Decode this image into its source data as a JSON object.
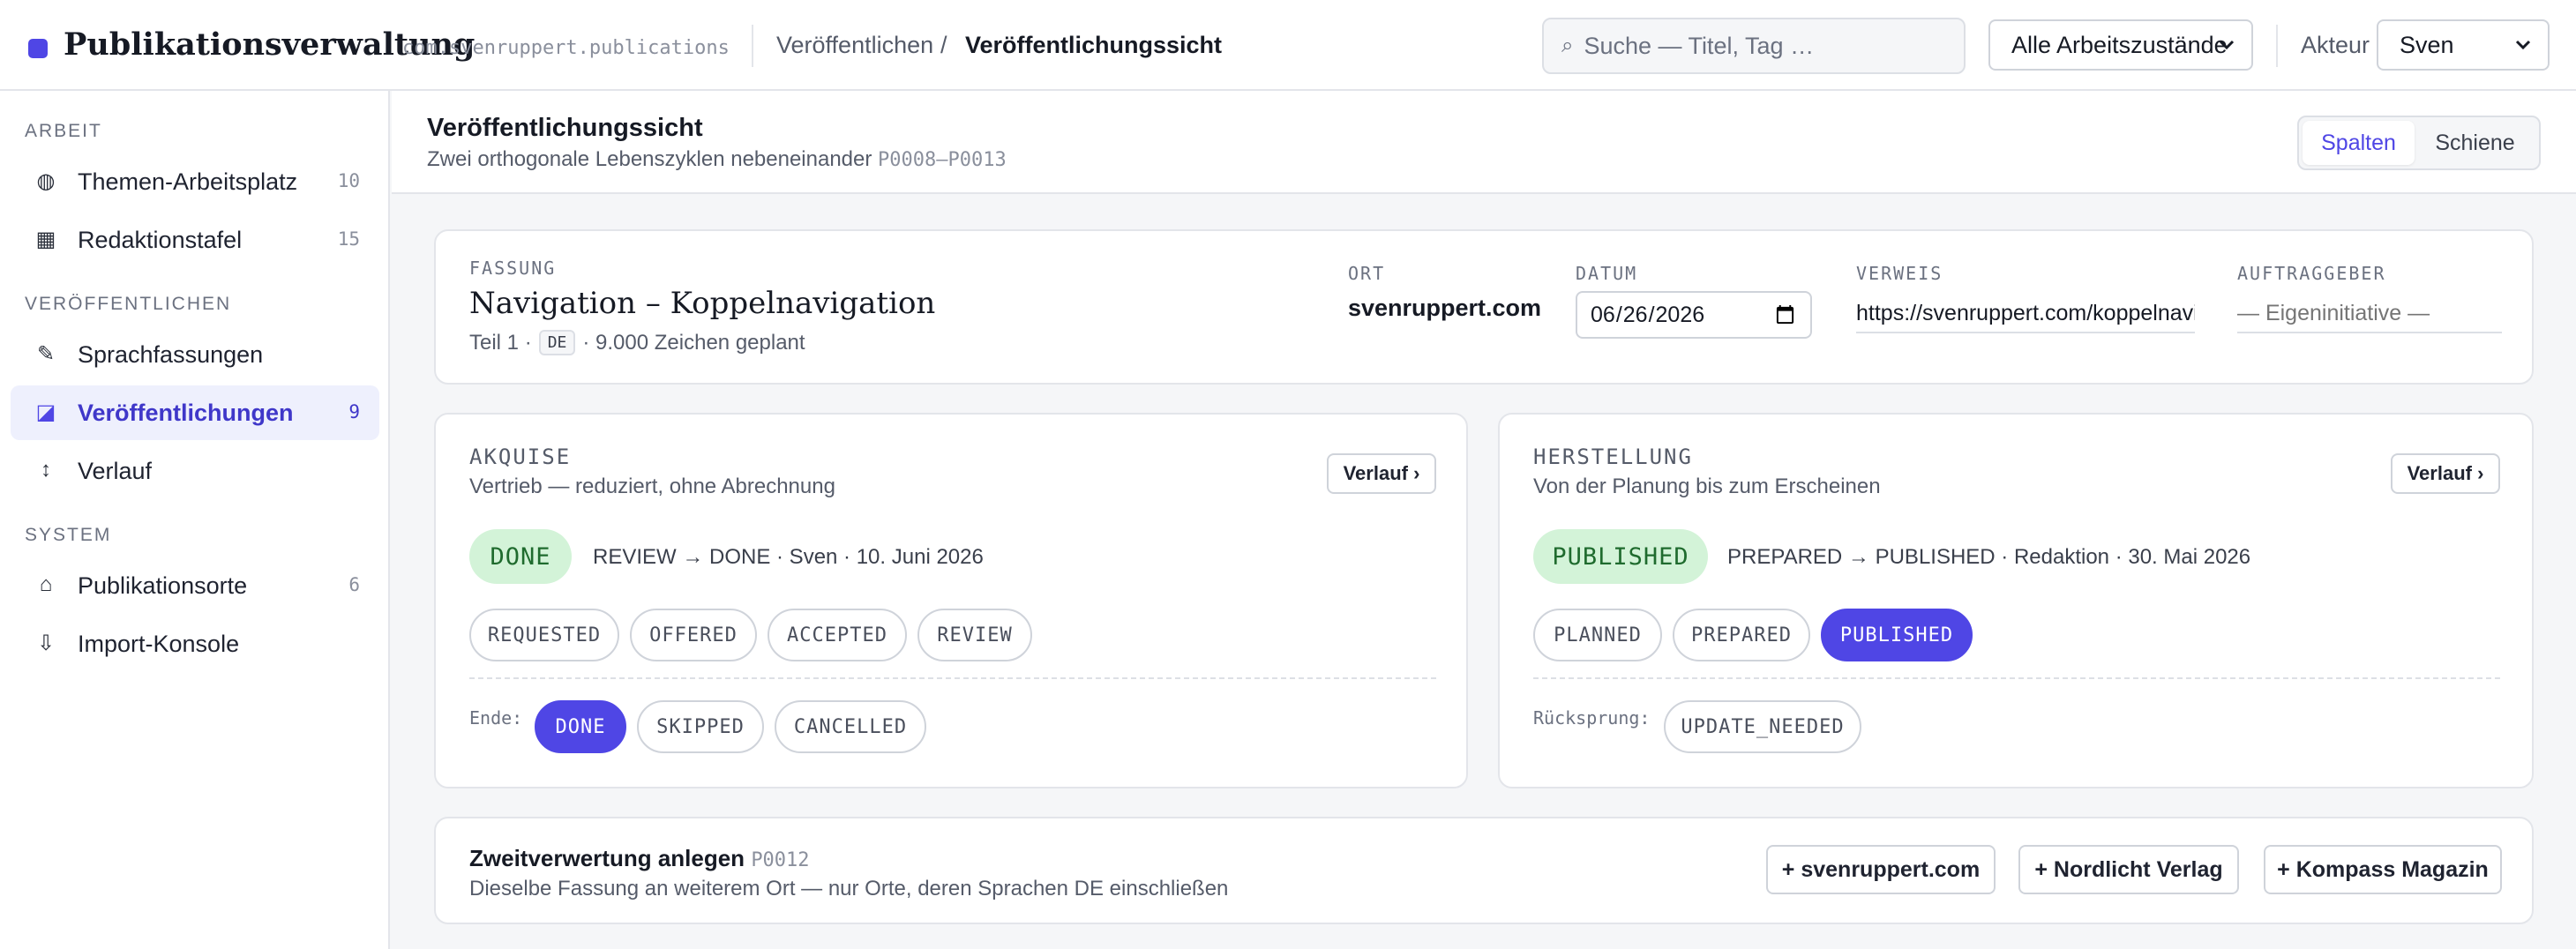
{
  "app": {
    "title": "Publikationsverwaltung",
    "id": "com.svenruppert.publications"
  },
  "breadcrumb": {
    "parent": "Veröffentlichen",
    "separator": "/",
    "current": "Veröffentlichungssicht"
  },
  "search": {
    "placeholder": "Suche — Titel, Tag …",
    "value": "",
    "icon": "search-icon"
  },
  "filter": {
    "selected": "Alle Arbeitszustände"
  },
  "actor": {
    "label": "Akteur",
    "selected": "Sven"
  },
  "sidebar": {
    "sections": [
      {
        "title": "ARBEIT",
        "items": [
          {
            "label": "Themen-Arbeitsplatz",
            "count": "10",
            "icon": "globe-icon",
            "glyph": "◍"
          },
          {
            "label": "Redaktionstafel",
            "count": "15",
            "icon": "board-icon",
            "glyph": "▦"
          }
        ]
      },
      {
        "title": "VERÖFFENTLICHEN",
        "items": [
          {
            "label": "Sprachfassungen",
            "count": "",
            "icon": "pencil-icon",
            "glyph": "✎"
          },
          {
            "label": "Veröffentlichungen",
            "count": "9",
            "icon": "publication-icon",
            "glyph": "◪",
            "active": true
          },
          {
            "label": "Verlauf",
            "count": "",
            "icon": "updown-arrow-icon",
            "glyph": "↕"
          }
        ]
      },
      {
        "title": "SYSTEM",
        "items": [
          {
            "label": "Publikationsorte",
            "count": "6",
            "icon": "home-icon",
            "glyph": "⌂"
          },
          {
            "label": "Import-Konsole",
            "count": "",
            "icon": "download-arrow-icon",
            "glyph": "⇩"
          }
        ]
      }
    ]
  },
  "page": {
    "title": "Veröffentlichungssicht",
    "subtitle": "Zwei orthogonale Lebenszyklen nebeneinander",
    "subtitle_ref": "P0008–P0013",
    "view_toggle": {
      "columns": "Spalten",
      "rail": "Schiene",
      "active": "columns"
    }
  },
  "fassung": {
    "label": "FASSUNG",
    "title": "Navigation – Koppelnavigation",
    "meta_prefix": "Teil 1 ·",
    "lang": "DE",
    "meta_suffix": "· 9.000 Zeichen geplant",
    "ort_label": "ORT",
    "ort": "svenruppert.com",
    "datum_label": "DATUM",
    "datum": "2026-06-26",
    "verweis_label": "VERWEIS",
    "verweis": "https://svenruppert.com/koppelnavigation",
    "auftraggeber_label": "AUFTRAGGEBER",
    "auftraggeber_placeholder": "— Eigeninitiative —"
  },
  "akquise": {
    "label": "AKQUISE",
    "subtitle": "Vertrieb — reduziert, ohne Abrechnung",
    "history_button": "Verlauf ›",
    "state": "DONE",
    "transition": "REVIEW → DONE · Sven · 10. Juni 2026",
    "steps": [
      "REQUESTED",
      "OFFERED",
      "ACCEPTED",
      "REVIEW"
    ],
    "end_label": "Ende:",
    "end_steps": [
      "DONE",
      "SKIPPED",
      "CANCELLED"
    ],
    "selected": "DONE"
  },
  "herstellung": {
    "label": "HERSTELLUNG",
    "subtitle": "Von der Planung bis zum Erscheinen",
    "history_button": "Verlauf ›",
    "state": "PUBLISHED",
    "transition": "PREPARED → PUBLISHED · Redaktion · 30. Mai 2026",
    "steps": [
      "PLANNED",
      "PREPARED",
      "PUBLISHED"
    ],
    "back_label": "Rücksprung:",
    "back_steps": [
      "UPDATE_NEEDED"
    ],
    "selected": "PUBLISHED"
  },
  "zweit": {
    "title": "Zweitverwertung anlegen",
    "ref": "P0012",
    "subtitle": "Dieselbe Fassung an weiterem Ort — nur Orte, deren Sprachen DE einschließen",
    "buttons": [
      "+ svenruppert.com",
      "+ Nordlicht Verlag",
      "+ Kompass Magazin"
    ]
  },
  "colors": {
    "accent": "#4f46e5",
    "success_bg": "#d3f3d8",
    "success_text": "#1f6b2e"
  }
}
